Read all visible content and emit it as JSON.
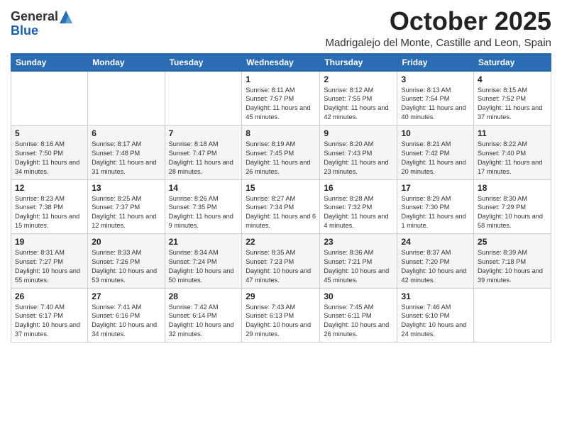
{
  "logo": {
    "general": "General",
    "blue": "Blue"
  },
  "header": {
    "month": "October 2025",
    "location": "Madrigalejo del Monte, Castille and Leon, Spain"
  },
  "days_of_week": [
    "Sunday",
    "Monday",
    "Tuesday",
    "Wednesday",
    "Thursday",
    "Friday",
    "Saturday"
  ],
  "weeks": [
    [
      {
        "day": "",
        "info": ""
      },
      {
        "day": "",
        "info": ""
      },
      {
        "day": "",
        "info": ""
      },
      {
        "day": "1",
        "info": "Sunrise: 8:11 AM\nSunset: 7:57 PM\nDaylight: 11 hours and 45 minutes."
      },
      {
        "day": "2",
        "info": "Sunrise: 8:12 AM\nSunset: 7:55 PM\nDaylight: 11 hours and 42 minutes."
      },
      {
        "day": "3",
        "info": "Sunrise: 8:13 AM\nSunset: 7:54 PM\nDaylight: 11 hours and 40 minutes."
      },
      {
        "day": "4",
        "info": "Sunrise: 8:15 AM\nSunset: 7:52 PM\nDaylight: 11 hours and 37 minutes."
      }
    ],
    [
      {
        "day": "5",
        "info": "Sunrise: 8:16 AM\nSunset: 7:50 PM\nDaylight: 11 hours and 34 minutes."
      },
      {
        "day": "6",
        "info": "Sunrise: 8:17 AM\nSunset: 7:48 PM\nDaylight: 11 hours and 31 minutes."
      },
      {
        "day": "7",
        "info": "Sunrise: 8:18 AM\nSunset: 7:47 PM\nDaylight: 11 hours and 28 minutes."
      },
      {
        "day": "8",
        "info": "Sunrise: 8:19 AM\nSunset: 7:45 PM\nDaylight: 11 hours and 26 minutes."
      },
      {
        "day": "9",
        "info": "Sunrise: 8:20 AM\nSunset: 7:43 PM\nDaylight: 11 hours and 23 minutes."
      },
      {
        "day": "10",
        "info": "Sunrise: 8:21 AM\nSunset: 7:42 PM\nDaylight: 11 hours and 20 minutes."
      },
      {
        "day": "11",
        "info": "Sunrise: 8:22 AM\nSunset: 7:40 PM\nDaylight: 11 hours and 17 minutes."
      }
    ],
    [
      {
        "day": "12",
        "info": "Sunrise: 8:23 AM\nSunset: 7:38 PM\nDaylight: 11 hours and 15 minutes."
      },
      {
        "day": "13",
        "info": "Sunrise: 8:25 AM\nSunset: 7:37 PM\nDaylight: 11 hours and 12 minutes."
      },
      {
        "day": "14",
        "info": "Sunrise: 8:26 AM\nSunset: 7:35 PM\nDaylight: 11 hours and 9 minutes."
      },
      {
        "day": "15",
        "info": "Sunrise: 8:27 AM\nSunset: 7:34 PM\nDaylight: 11 hours and 6 minutes."
      },
      {
        "day": "16",
        "info": "Sunrise: 8:28 AM\nSunset: 7:32 PM\nDaylight: 11 hours and 4 minutes."
      },
      {
        "day": "17",
        "info": "Sunrise: 8:29 AM\nSunset: 7:30 PM\nDaylight: 11 hours and 1 minute."
      },
      {
        "day": "18",
        "info": "Sunrise: 8:30 AM\nSunset: 7:29 PM\nDaylight: 10 hours and 58 minutes."
      }
    ],
    [
      {
        "day": "19",
        "info": "Sunrise: 8:31 AM\nSunset: 7:27 PM\nDaylight: 10 hours and 55 minutes."
      },
      {
        "day": "20",
        "info": "Sunrise: 8:33 AM\nSunset: 7:26 PM\nDaylight: 10 hours and 53 minutes."
      },
      {
        "day": "21",
        "info": "Sunrise: 8:34 AM\nSunset: 7:24 PM\nDaylight: 10 hours and 50 minutes."
      },
      {
        "day": "22",
        "info": "Sunrise: 8:35 AM\nSunset: 7:23 PM\nDaylight: 10 hours and 47 minutes."
      },
      {
        "day": "23",
        "info": "Sunrise: 8:36 AM\nSunset: 7:21 PM\nDaylight: 10 hours and 45 minutes."
      },
      {
        "day": "24",
        "info": "Sunrise: 8:37 AM\nSunset: 7:20 PM\nDaylight: 10 hours and 42 minutes."
      },
      {
        "day": "25",
        "info": "Sunrise: 8:39 AM\nSunset: 7:18 PM\nDaylight: 10 hours and 39 minutes."
      }
    ],
    [
      {
        "day": "26",
        "info": "Sunrise: 7:40 AM\nSunset: 6:17 PM\nDaylight: 10 hours and 37 minutes."
      },
      {
        "day": "27",
        "info": "Sunrise: 7:41 AM\nSunset: 6:16 PM\nDaylight: 10 hours and 34 minutes."
      },
      {
        "day": "28",
        "info": "Sunrise: 7:42 AM\nSunset: 6:14 PM\nDaylight: 10 hours and 32 minutes."
      },
      {
        "day": "29",
        "info": "Sunrise: 7:43 AM\nSunset: 6:13 PM\nDaylight: 10 hours and 29 minutes."
      },
      {
        "day": "30",
        "info": "Sunrise: 7:45 AM\nSunset: 6:11 PM\nDaylight: 10 hours and 26 minutes."
      },
      {
        "day": "31",
        "info": "Sunrise: 7:46 AM\nSunset: 6:10 PM\nDaylight: 10 hours and 24 minutes."
      },
      {
        "day": "",
        "info": ""
      }
    ]
  ]
}
